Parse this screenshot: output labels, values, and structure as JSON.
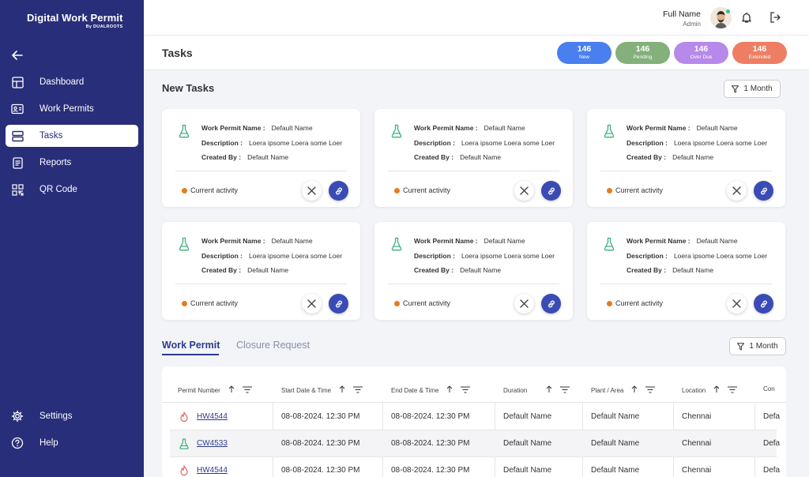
{
  "brand": {
    "title": "Digital Work Permit",
    "subtitle": "By DUALROOTS"
  },
  "sidebar": {
    "items": [
      {
        "label": "Dashboard",
        "icon": "dashboard-icon"
      },
      {
        "label": "Work Permits",
        "icon": "id-card-icon"
      },
      {
        "label": "Tasks",
        "icon": "tasks-icon",
        "active": true
      },
      {
        "label": "Reports",
        "icon": "report-icon"
      },
      {
        "label": "QR Code",
        "icon": "qr-code-icon"
      },
      {
        "label": "Settings",
        "icon": "gear-icon"
      },
      {
        "label": "Help",
        "icon": "help-icon"
      }
    ]
  },
  "user": {
    "name": "Full Name",
    "role": "Admin"
  },
  "page": {
    "title": "Tasks"
  },
  "stats": [
    {
      "count": "146",
      "label": "New",
      "color": "#4a7ff0"
    },
    {
      "count": "146",
      "label": "Pending",
      "color": "#84b07b"
    },
    {
      "count": "146",
      "label": "Over Due",
      "color": "#b789ea"
    },
    {
      "count": "146",
      "label": "Extended",
      "color": "#ee7e63"
    }
  ],
  "new_tasks": {
    "title": "New Tasks",
    "filter_label": "1 Month",
    "cards": [
      {
        "permit_label": "Work Permit Name :",
        "permit_value": "Default Name",
        "desc_label": "Description :",
        "desc_value": "Loera ipsome Loera some Loer",
        "created_label": "Created By :",
        "created_value": "Default Name",
        "activity": "Current activity"
      },
      {
        "permit_label": "Work Permit Name :",
        "permit_value": "Default Name",
        "desc_label": "Description :",
        "desc_value": "Loera ipsome Loera some Loer",
        "created_label": "Created By :",
        "created_value": "Default Name",
        "activity": "Current activity"
      },
      {
        "permit_label": "Work Permit Name :",
        "permit_value": "Default Name",
        "desc_label": "Description :",
        "desc_value": "Loera ipsome Loera some Loer",
        "created_label": "Created By :",
        "created_value": "Default Name",
        "activity": "Current activity"
      },
      {
        "permit_label": "Work Permit Name :",
        "permit_value": "Default Name",
        "desc_label": "Description :",
        "desc_value": "Loera ipsome Loera some Loer",
        "created_label": "Created By :",
        "created_value": "Default Name",
        "activity": "Current activity"
      },
      {
        "permit_label": "Work Permit Name :",
        "permit_value": "Default Name",
        "desc_label": "Description :",
        "desc_value": "Loera ipsome Loera some Loer",
        "created_label": "Created By :",
        "created_value": "Default Name",
        "activity": "Current activity"
      },
      {
        "permit_label": "Work Permit Name :",
        "permit_value": "Default Name",
        "desc_label": "Description :",
        "desc_value": "Loera ipsome Loera some Loer",
        "created_label": "Created By :",
        "created_value": "Default Name",
        "activity": "Current activity"
      }
    ]
  },
  "tabs": [
    {
      "label": "Work Permit",
      "active": true
    },
    {
      "label": "Closure Request",
      "active": false
    }
  ],
  "table": {
    "filter_label": "1 Month",
    "columns": [
      "Permit Number",
      "Start Date & Time",
      "End Date & Time",
      "Duration",
      "Plant / Area",
      "Location",
      "Con"
    ],
    "rows": [
      {
        "icon": "fire-icon",
        "permit": "HW4544",
        "start": "08-08-2024. 12:30 PM",
        "end": "08-08-2024. 12:30 PM",
        "duration": "Default Name",
        "plant": "Default Name",
        "location": "Chennai",
        "extra": "Defa"
      },
      {
        "icon": "flask-icon",
        "permit": "CW4533",
        "start": "08-08-2024. 12:30 PM",
        "end": "08-08-2024. 12:30 PM",
        "duration": "Default Name",
        "plant": "Default Name",
        "location": "Chennai",
        "extra": "Defa"
      },
      {
        "icon": "fire-icon",
        "permit": "HW4544",
        "start": "08-08-2024. 12:30 PM",
        "end": "08-08-2024. 12:30 PM",
        "duration": "Default Name",
        "plant": "Default Name",
        "location": "Chennai",
        "extra": "Defa"
      }
    ]
  }
}
